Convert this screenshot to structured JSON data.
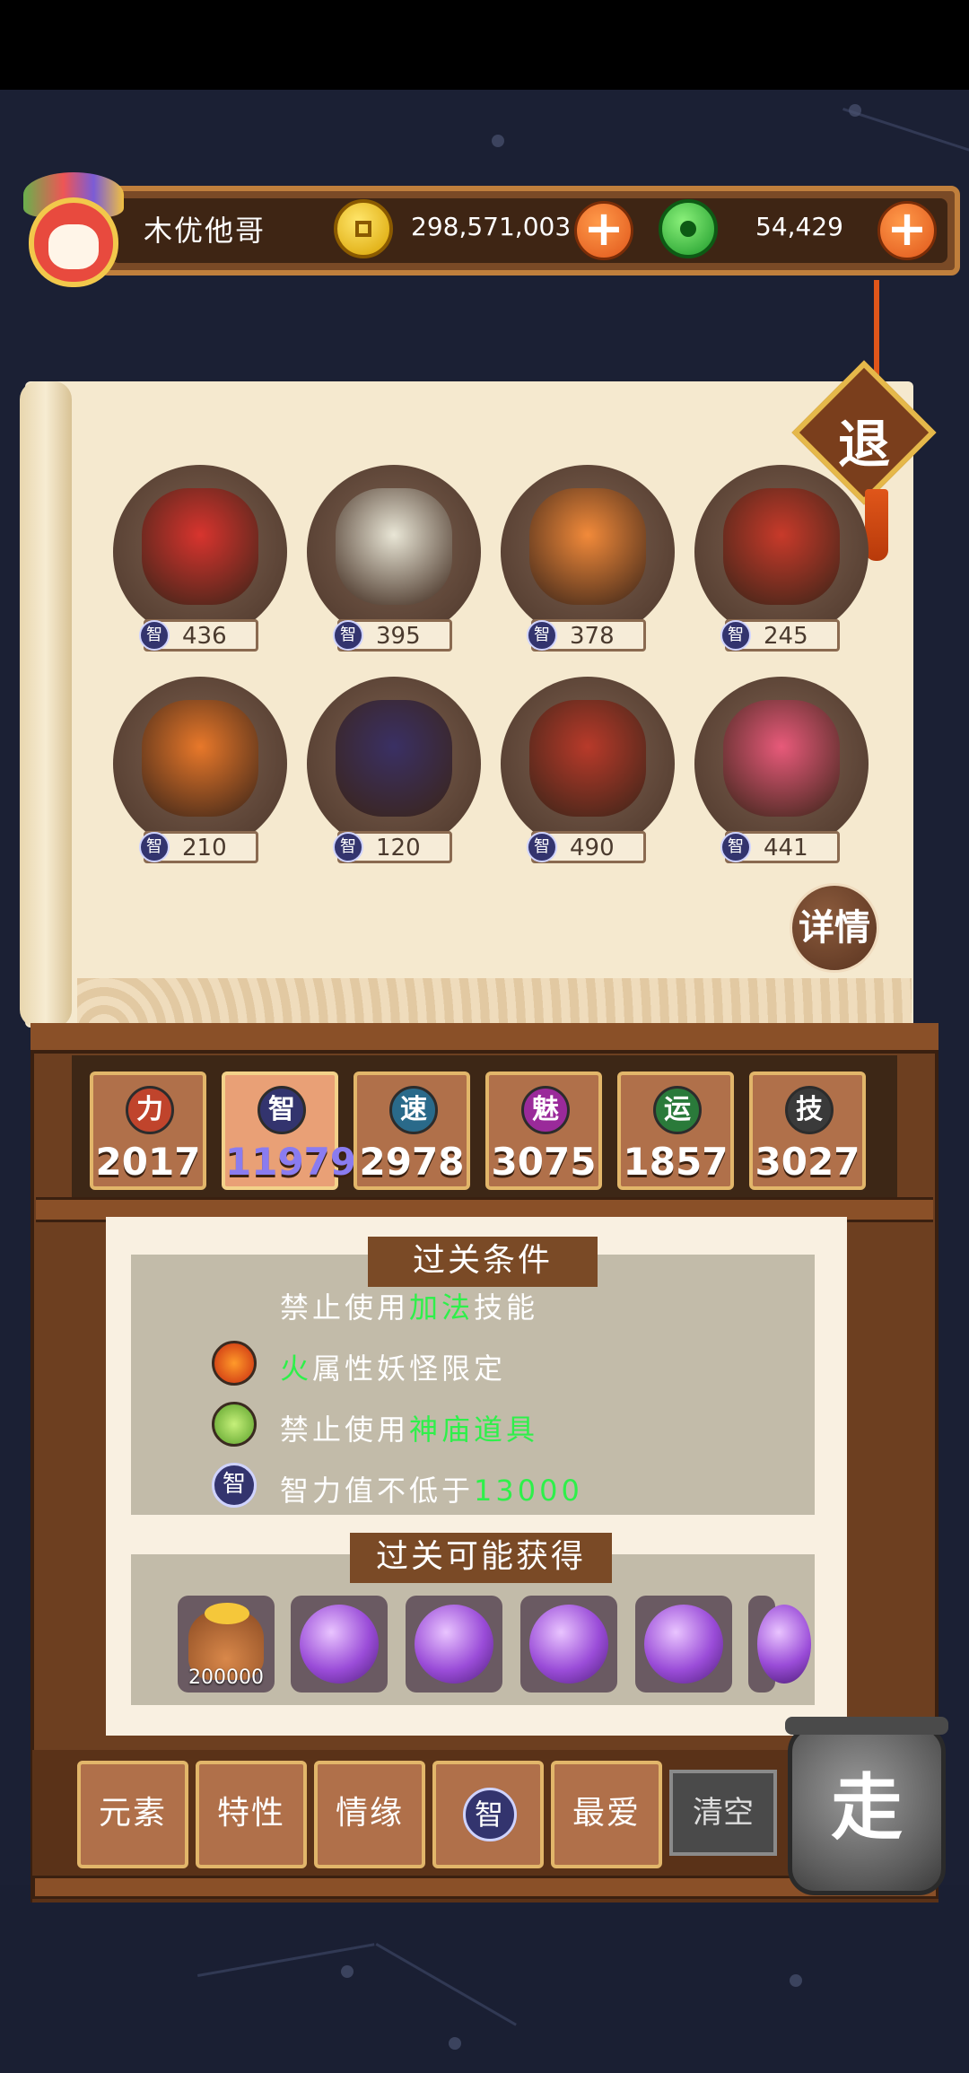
{
  "player": {
    "name": "木优他哥"
  },
  "currency": {
    "gold": "298,571,003",
    "gems": "54,429"
  },
  "exit_label": "退",
  "detail_label": "详情",
  "team": [
    {
      "zhi": "436",
      "color": "#d8342e"
    },
    {
      "zhi": "395",
      "color": "#e9e6d6"
    },
    {
      "zhi": "378",
      "color": "#f28a3a"
    },
    {
      "zhi": "245",
      "color": "#c83a2a"
    },
    {
      "zhi": "210",
      "color": "#e8782a"
    },
    {
      "zhi": "120",
      "color": "#3a3064"
    },
    {
      "zhi": "490",
      "color": "#b83a2a"
    },
    {
      "zhi": "441",
      "color": "#e85a7a"
    }
  ],
  "stat_icon": "智",
  "stats": [
    {
      "icon": "力",
      "value": "2017",
      "color": "#c0442c"
    },
    {
      "icon": "智",
      "value": "11979",
      "color": "#33346e"
    },
    {
      "icon": "速",
      "value": "2978",
      "color": "#2a6a8a"
    },
    {
      "icon": "魅",
      "value": "3075",
      "color": "#9a2a9a"
    },
    {
      "icon": "运",
      "value": "1857",
      "color": "#2a7a3a"
    },
    {
      "icon": "技",
      "value": "3027",
      "color": "#3a3a3a"
    }
  ],
  "conditions": {
    "title": "过关条件",
    "line1": {
      "pre": "禁止使用",
      "hl": "加法",
      "post": "技能"
    },
    "line2": {
      "hl": "火",
      "post": "属性妖怪限定"
    },
    "line3": {
      "pre": "禁止使用",
      "hl": "神庙道具"
    },
    "line4": {
      "pre": "智力值不低于",
      "hl": "13000"
    },
    "line4_icon": "智"
  },
  "rewards": {
    "title": "过关可能获得",
    "gold_amount": "200000"
  },
  "filters": [
    "元素",
    "特性",
    "情缘",
    "智",
    "最爱"
  ],
  "clear_label": "清空",
  "go_label": "走"
}
